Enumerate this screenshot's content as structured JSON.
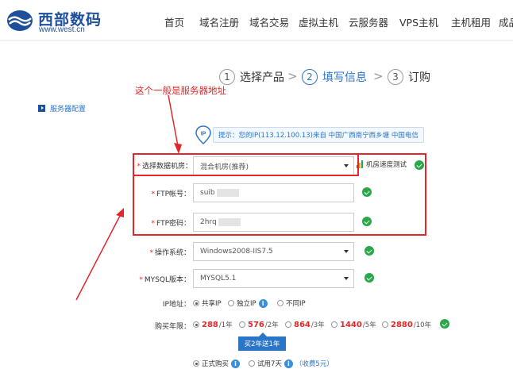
{
  "header": {
    "logo_title": "西部数码",
    "logo_url": "www.west.cn",
    "nav": [
      "首页",
      "域名注册",
      "域名交易",
      "虚拟主机",
      "云服务器",
      "VPS主机",
      "主机租用",
      "成品"
    ]
  },
  "steps": [
    {
      "num": "1",
      "label": "选择产品"
    },
    {
      "num": "2",
      "label": "填写信息"
    },
    {
      "num": "3",
      "label": "订购"
    }
  ],
  "annotation": "这个一般是服务器地址",
  "section_title": "服务器配置",
  "tip": "提示：您的IP(113.12.100.13)来自 中国广西南宁西乡塘 中国电信",
  "form": {
    "datacenter_label": "选择数据机房：",
    "datacenter_value": "混合机房(推荐)",
    "speed_test": "机房速度测试",
    "ftp_account_label": "FTP帐号：",
    "ftp_account_value": "suib",
    "ftp_password_label": "FTP密码：",
    "ftp_password_value": "2hrq",
    "os_label": "操作系统：",
    "os_value": "Windows2008-IIS7.5",
    "mysql_label": "MYSQL版本：",
    "mysql_value": "MYSQL5.1",
    "ip_label": "IP地址：",
    "ip_options": [
      "共享IP",
      "独立IP",
      "不同IP"
    ],
    "years_label": "购买年限：",
    "prices": [
      {
        "price": "288",
        "unit": "/1年"
      },
      {
        "price": "576",
        "unit": "/2年"
      },
      {
        "price": "864",
        "unit": "/3年"
      },
      {
        "price": "1440",
        "unit": "/5年"
      },
      {
        "price": "2880",
        "unit": "/10年"
      }
    ],
    "promo": "买2年送1年",
    "buy_options": [
      "正式购买",
      "试用7天",
      "（收费5元）"
    ]
  },
  "colors": {
    "brand": "#1d4f9b",
    "accent": "#2b75c8",
    "annotation_red": "#e2262a",
    "check_green": "#2aa747"
  }
}
